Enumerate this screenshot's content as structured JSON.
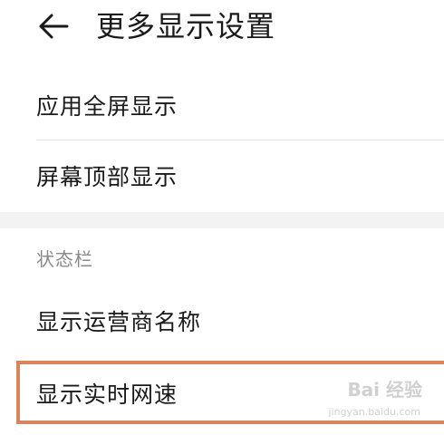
{
  "header": {
    "back_icon": "arrow-left-icon",
    "title": "更多显示设置"
  },
  "items": [
    {
      "label": "应用全屏显示"
    },
    {
      "label": "屏幕顶部显示"
    }
  ],
  "status_bar": {
    "section_title": "状态栏",
    "items": [
      {
        "label": "显示运营商名称"
      },
      {
        "label": "显示实时网速"
      }
    ]
  },
  "watermark": {
    "text": "Bai 经验",
    "sub": "jingyan.baidu.com"
  },
  "colors": {
    "highlight_border": "#d9855c",
    "section_gap": "#f3f3f3",
    "section_text": "#8a8a8a"
  }
}
